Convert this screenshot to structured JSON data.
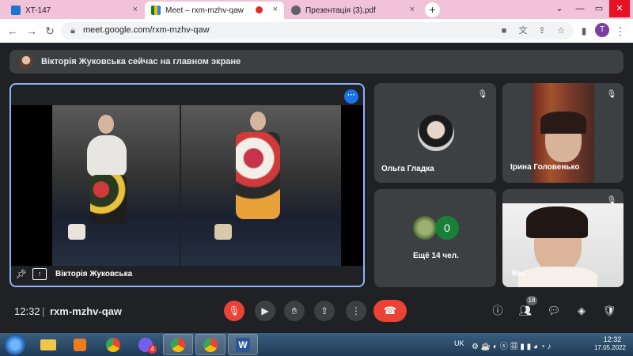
{
  "browser": {
    "tabs": [
      {
        "title": "XT-147",
        "close": "×"
      },
      {
        "title": "Meet – rxm-mzhv-qaw",
        "close": "×"
      },
      {
        "title": "Презентація (3).pdf",
        "close": "×"
      }
    ],
    "new_tab": "+",
    "url": "meet.google.com/rxm-mzhv-qaw",
    "profile_initial": "T"
  },
  "meet": {
    "banner_text": "Вікторія Жуковська сейчас на главном экране",
    "presenter_name": "Вікторія Жуковська",
    "participants": [
      {
        "name": "Ольга Гладка"
      },
      {
        "name": "Ірина Головенько"
      },
      {
        "name": "Вы"
      }
    ],
    "more_tile": {
      "count_badge": "0",
      "label": "Ещё 14 чел."
    },
    "time": "12:32",
    "separator": "|",
    "meeting_code": "rxm-mzhv-qaw",
    "people_badge": "18"
  },
  "taskbar": {
    "word_label": "W",
    "viber_badge": "4",
    "language": "UK",
    "clock_time": "12:32",
    "clock_date": "17.05.2022"
  },
  "colors": {
    "accent": "#1a73e8",
    "danger": "#ea4335",
    "tile_bg": "#3c4043",
    "page_bg": "#202124",
    "tabstrip": "#f1c2d8"
  }
}
